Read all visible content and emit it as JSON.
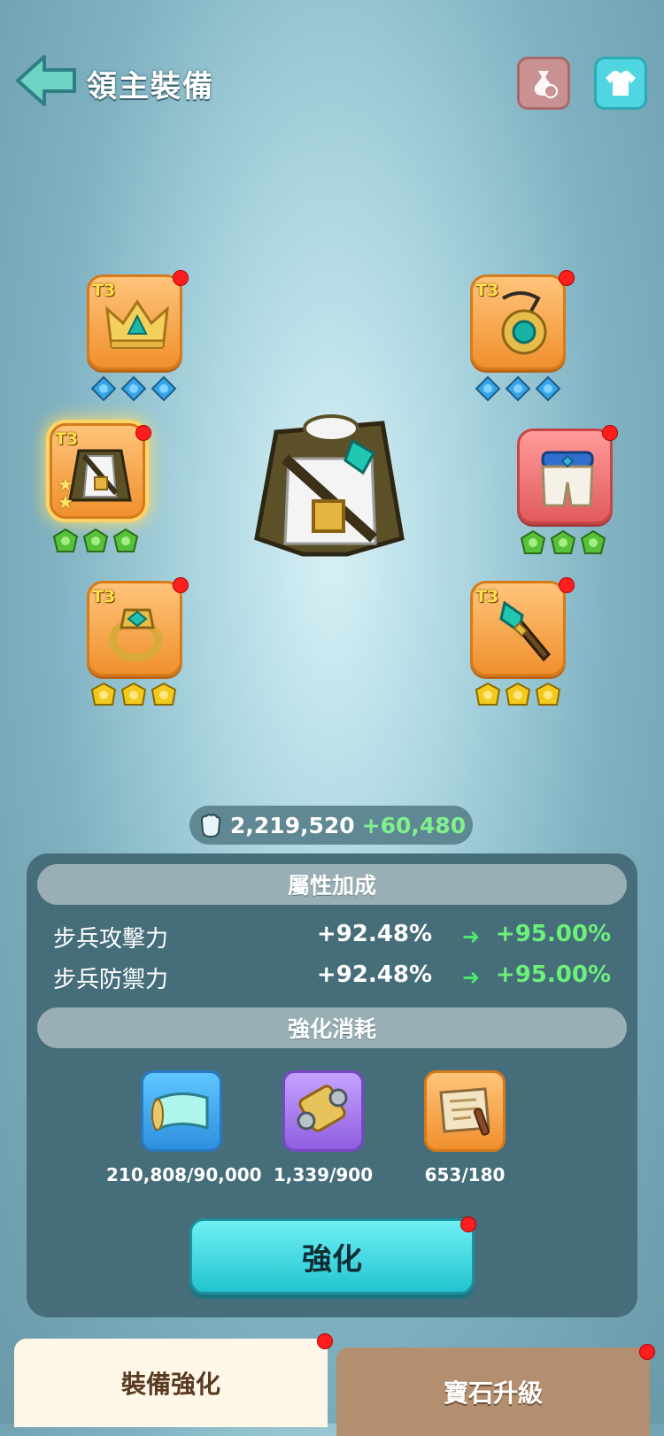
{
  "header": {
    "title": "領主裝備",
    "bag_button_icon": "bag-swap-icon",
    "shirt_button_icon": "shirt-icon"
  },
  "slots": [
    {
      "id": "crown",
      "tier": "T3",
      "icon": "crown-icon",
      "gem_type": "blue",
      "gem_count": 3
    },
    {
      "id": "amulet",
      "tier": "T3",
      "icon": "amulet-icon",
      "gem_type": "blue",
      "gem_count": 3
    },
    {
      "id": "armor",
      "tier": "T3",
      "icon": "armor-icon",
      "stars": 2,
      "gem_type": "green",
      "gem_count": 3,
      "selected": true
    },
    {
      "id": "pants",
      "tier": "",
      "icon": "pants-icon",
      "gem_type": "green",
      "gem_count": 3
    },
    {
      "id": "ring",
      "tier": "T3",
      "icon": "ring-icon",
      "gem_type": "gold",
      "gem_count": 3
    },
    {
      "id": "scepter",
      "tier": "T3",
      "icon": "scepter-icon",
      "gem_type": "gold",
      "gem_count": 3
    }
  ],
  "power": {
    "icon": "fist-icon",
    "value": "2,219,520",
    "gain": "+60,480"
  },
  "attributes": {
    "header": "屬性加成",
    "rows": [
      {
        "name": "步兵攻擊力",
        "current": "+92.48%",
        "next": "+95.00%"
      },
      {
        "name": "步兵防禦力",
        "current": "+92.48%",
        "next": "+95.00%"
      }
    ]
  },
  "cost": {
    "header": "強化消耗",
    "items": [
      {
        "icon": "blueprint-scroll-icon",
        "value": "210,808/90,000"
      },
      {
        "icon": "thread-spool-icon",
        "value": "1,339/900"
      },
      {
        "icon": "map-scroll-icon",
        "value": "653/180"
      }
    ]
  },
  "enhance_button": "強化",
  "tabs": [
    {
      "label": "裝備強化",
      "active": true
    },
    {
      "label": "寶石升級",
      "active": false
    }
  ],
  "colors": {
    "accent": "#22c4cf",
    "gain": "#6cf07a",
    "notify": "#ff1e1e"
  }
}
